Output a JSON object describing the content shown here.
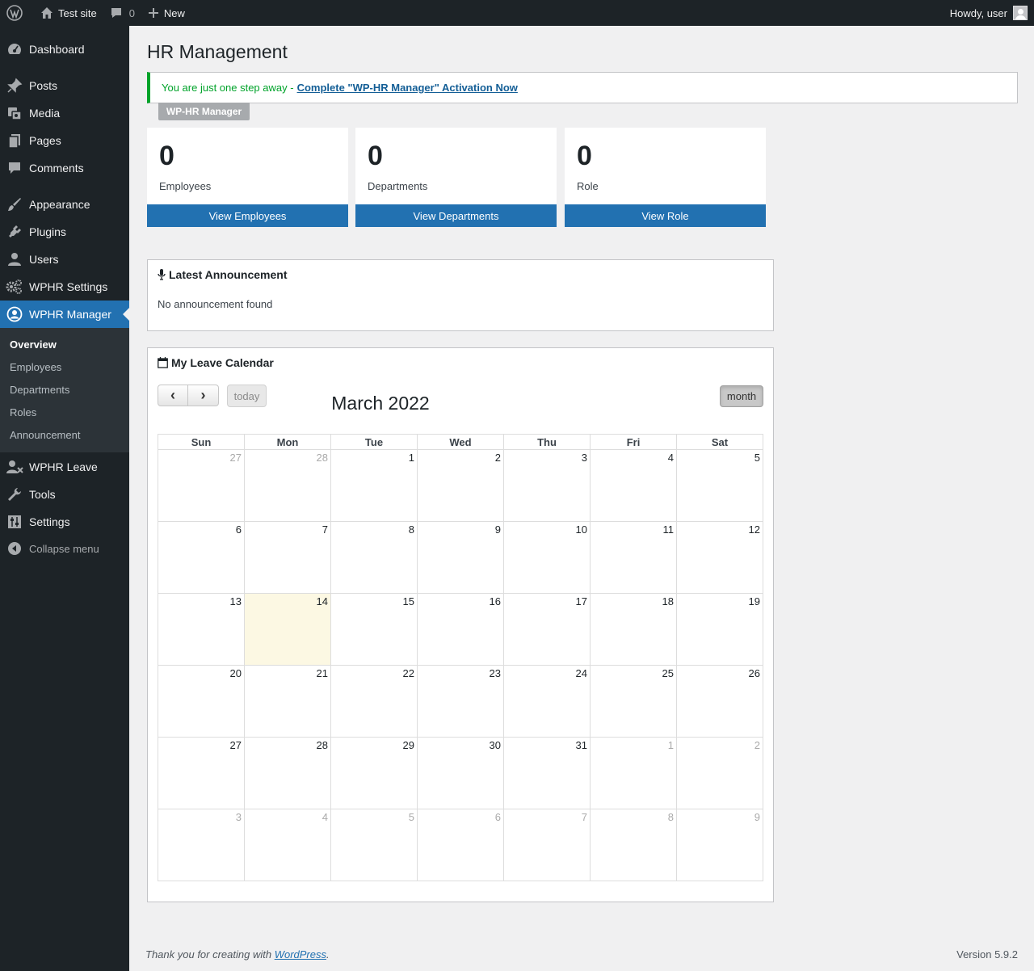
{
  "admin_bar": {
    "site_name": "Test site",
    "comments_count": "0",
    "new_label": "New",
    "greeting": "Howdy, user"
  },
  "sidebar": {
    "items": [
      {
        "label": "Dashboard",
        "icon": "dashboard-icon"
      },
      {
        "label": "Posts",
        "icon": "pushpin-icon"
      },
      {
        "label": "Media",
        "icon": "media-icon"
      },
      {
        "label": "Pages",
        "icon": "pages-icon"
      },
      {
        "label": "Comments",
        "icon": "comment-icon"
      },
      {
        "label": "Appearance",
        "icon": "paintbrush-icon"
      },
      {
        "label": "Plugins",
        "icon": "plugin-icon"
      },
      {
        "label": "Users",
        "icon": "user-icon"
      },
      {
        "label": "WPHR Settings",
        "icon": "gears-icon"
      },
      {
        "label": "WPHR Manager",
        "icon": "user-circle-icon"
      },
      {
        "label": "WPHR Leave",
        "icon": "user-remove-icon"
      },
      {
        "label": "Tools",
        "icon": "wrench-icon"
      },
      {
        "label": "Settings",
        "icon": "settings-sliders-icon"
      }
    ],
    "submenu": [
      "Overview",
      "Employees",
      "Departments",
      "Roles",
      "Announcement"
    ],
    "collapse_label": "Collapse menu"
  },
  "page": {
    "title": "HR Management",
    "notice_text": "You are just one step away - ",
    "notice_link": "Complete \"WP-HR Manager\" Activation Now",
    "badge": "WP-HR Manager"
  },
  "stats": [
    {
      "count": "0",
      "label": "Employees",
      "button": "View Employees"
    },
    {
      "count": "0",
      "label": "Departments",
      "button": "View Departments"
    },
    {
      "count": "0",
      "label": "Role",
      "button": "View Role"
    }
  ],
  "announcement": {
    "title": "Latest Announcement",
    "empty_text": "No announcement found"
  },
  "calendar": {
    "title": "My Leave Calendar",
    "month_title": "March 2022",
    "prev_label": "‹",
    "next_label": "›",
    "today_label": "today",
    "view_label": "month",
    "weekdays": [
      "Sun",
      "Mon",
      "Tue",
      "Wed",
      "Thu",
      "Fri",
      "Sat"
    ],
    "weeks": [
      [
        {
          "d": "27",
          "o": true
        },
        {
          "d": "28",
          "o": true
        },
        {
          "d": "1"
        },
        {
          "d": "2"
        },
        {
          "d": "3"
        },
        {
          "d": "4"
        },
        {
          "d": "5"
        }
      ],
      [
        {
          "d": "6"
        },
        {
          "d": "7"
        },
        {
          "d": "8"
        },
        {
          "d": "9"
        },
        {
          "d": "10"
        },
        {
          "d": "11"
        },
        {
          "d": "12"
        }
      ],
      [
        {
          "d": "13"
        },
        {
          "d": "14",
          "t": true
        },
        {
          "d": "15"
        },
        {
          "d": "16"
        },
        {
          "d": "17"
        },
        {
          "d": "18"
        },
        {
          "d": "19"
        }
      ],
      [
        {
          "d": "20"
        },
        {
          "d": "21"
        },
        {
          "d": "22"
        },
        {
          "d": "23"
        },
        {
          "d": "24"
        },
        {
          "d": "25"
        },
        {
          "d": "26"
        }
      ],
      [
        {
          "d": "27"
        },
        {
          "d": "28"
        },
        {
          "d": "29"
        },
        {
          "d": "30"
        },
        {
          "d": "31"
        },
        {
          "d": "1",
          "o": true
        },
        {
          "d": "2",
          "o": true
        }
      ],
      [
        {
          "d": "3",
          "o": true
        },
        {
          "d": "4",
          "o": true
        },
        {
          "d": "5",
          "o": true
        },
        {
          "d": "6",
          "o": true
        },
        {
          "d": "7",
          "o": true
        },
        {
          "d": "8",
          "o": true
        },
        {
          "d": "9",
          "o": true
        }
      ]
    ]
  },
  "footer": {
    "thanks_prefix": "Thank you for creating with ",
    "thanks_link": "WordPress",
    "thanks_suffix": ".",
    "version": "Version 5.9.2"
  },
  "colors": {
    "accent": "#2271b1",
    "sidebar_bg": "#1d2327",
    "notice_border": "#00a32a",
    "today_bg": "#fcf8e3"
  }
}
